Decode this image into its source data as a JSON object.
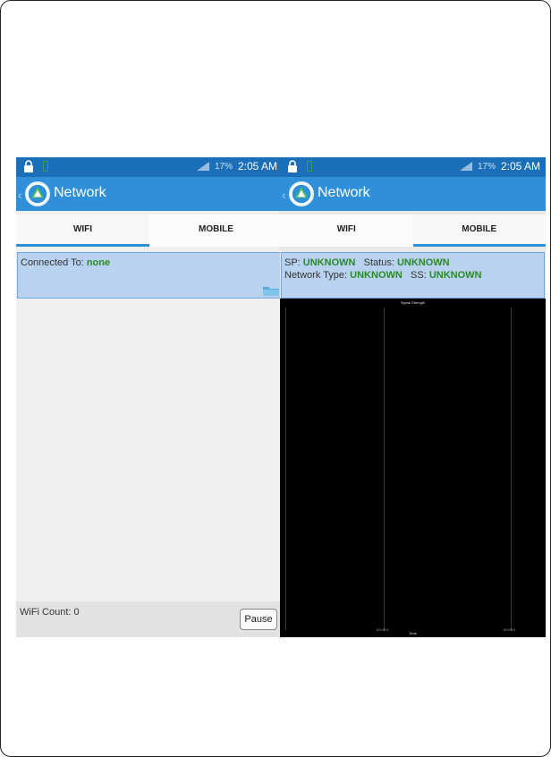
{
  "left_screen": {
    "status": {
      "battery_pct": "17%",
      "time": "2:05 AM"
    },
    "app_title": "Network",
    "tabs": [
      {
        "label": "WIFI",
        "active": true
      },
      {
        "label": "MOBILE",
        "active": false
      }
    ],
    "info": {
      "connected_label": "Connected To:",
      "connected_value": "none"
    },
    "footer": {
      "count_label": "WiFi Count:",
      "count_value": "0",
      "pause_label": "Pause"
    }
  },
  "right_screen": {
    "status": {
      "battery_pct": "17%",
      "time": "2:05 AM"
    },
    "app_title": "Network",
    "tabs": [
      {
        "label": "WIFI",
        "active": false
      },
      {
        "label": "MOBILE",
        "active": true
      }
    ],
    "info": {
      "sp_label": "SP:",
      "sp_value": "UNKNOWN",
      "status_label": "Status:",
      "status_value": "UNKNOWN",
      "network_type_label": "Network Type:",
      "network_type_value": "UNKNOWN",
      "ss_label": "SS:",
      "ss_value": "UNKNOWN"
    },
    "chart": {
      "title": "Signal Strength",
      "xlabel": "Time",
      "ticks": [
        "02:05:4",
        "02:05:5"
      ]
    }
  },
  "colors": {
    "status_bar": "#1a6fb8",
    "app_bar": "#2f8fd8",
    "tab_indicator": "#2f8fd8",
    "value_green": "#2a8a2a",
    "info_box": "#b9d2ef"
  },
  "icons": [
    "lock-icon",
    "battery-icon",
    "signal-icon",
    "app-logo-icon",
    "folder-icon",
    "floating-button-icon"
  ]
}
